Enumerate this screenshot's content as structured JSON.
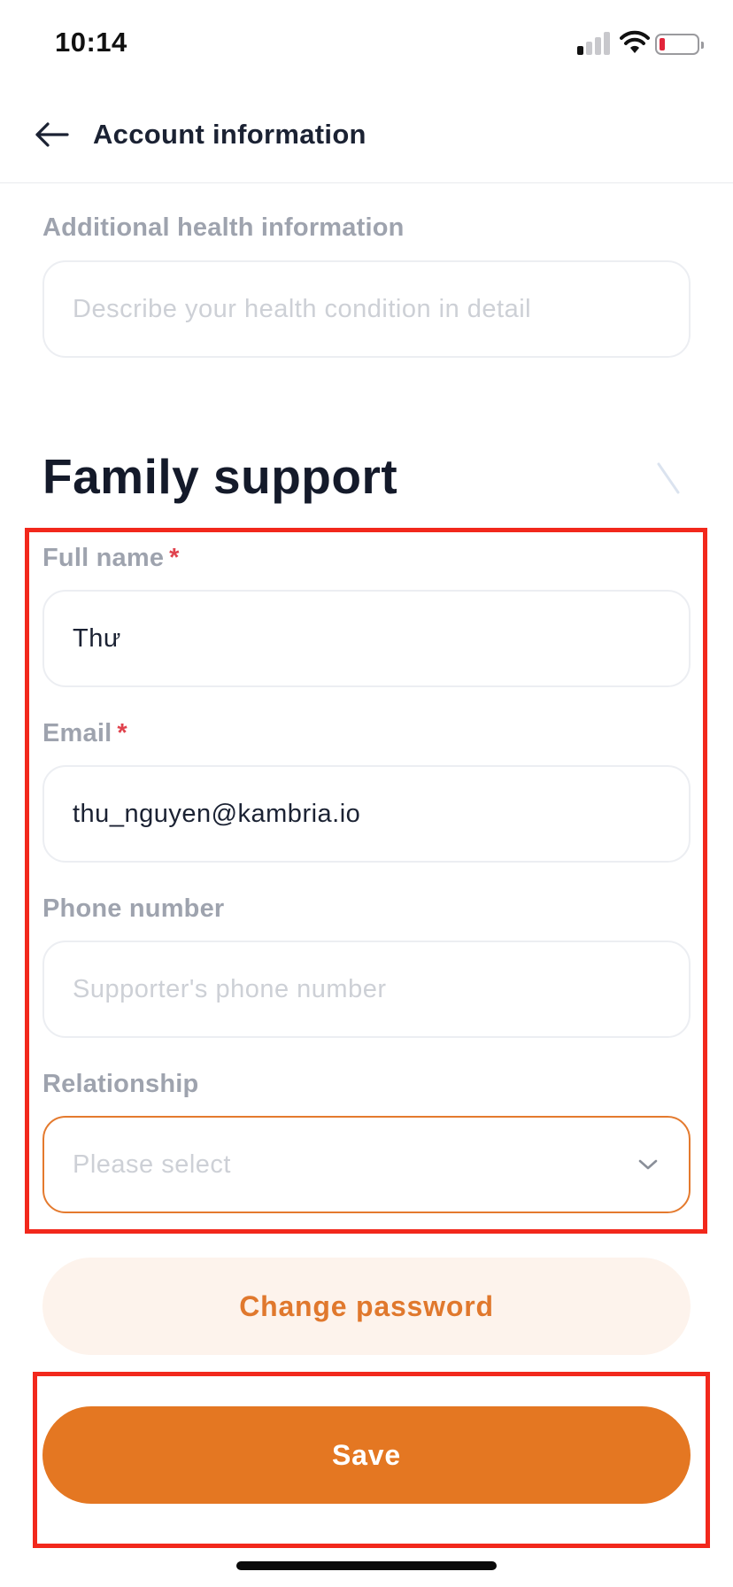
{
  "status_bar": {
    "time": "10:14",
    "battery_color": "#e2253a"
  },
  "header": {
    "back_icon": "arrow-left-icon",
    "title": "Account information"
  },
  "health": {
    "label": "Additional health information",
    "placeholder": "Describe your health condition in detail"
  },
  "family_support": {
    "title": "Family support",
    "full_name": {
      "label": "Full name",
      "required_mark": "*",
      "value": "Thư"
    },
    "email": {
      "label": "Email",
      "required_mark": "*",
      "value": "thu_nguyen@kambria.io"
    },
    "phone": {
      "label": "Phone number",
      "placeholder": "Supporter's phone number"
    },
    "relationship": {
      "label": "Relationship",
      "placeholder": "Please select",
      "icon": "chevron-down-icon"
    }
  },
  "buttons": {
    "change_password": "Change password",
    "save": "Save"
  },
  "colors": {
    "accent": "#e47722",
    "accent_light": "#fdf3ec",
    "highlight": "#f2281c",
    "required": "#e0424d"
  }
}
